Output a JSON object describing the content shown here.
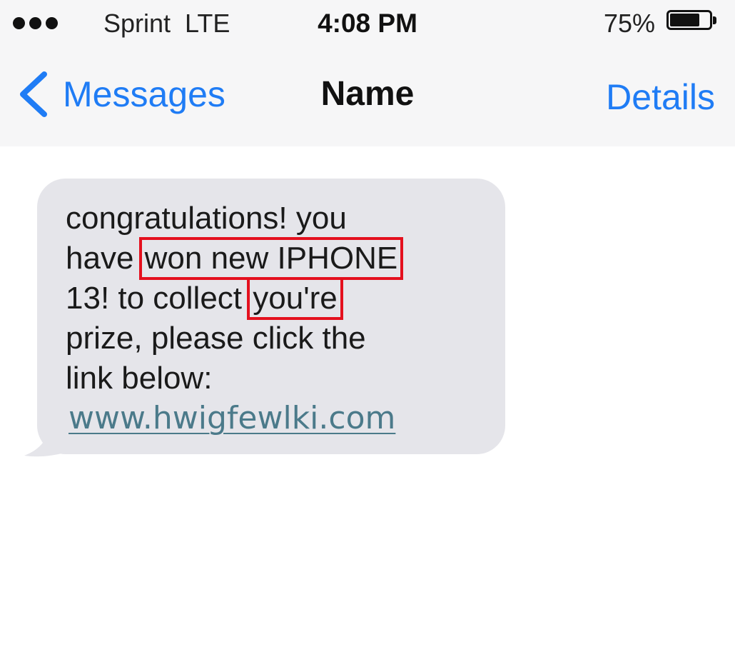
{
  "status_bar": {
    "carrier": "Sprint  LTE",
    "time": "4:08 PM",
    "battery_percent": "75%",
    "battery_level": 0.75
  },
  "nav": {
    "back_label": "Messages",
    "title": "Name",
    "details_label": "Details"
  },
  "message": {
    "line1": "congratulations! you",
    "line2_prefix": "have ",
    "line2_highlight": "won new IPHONE",
    "line3_prefix": "13! to collect ",
    "line3_highlight": "you're",
    "line4": "prize, please click the",
    "line5": "link below:",
    "link": "www.hwigfewlki.com"
  },
  "colors": {
    "accent": "#1f7cf5",
    "bubble": "#e5e5ea",
    "highlight_box": "#e4101e",
    "link": "#4b7a8a"
  }
}
